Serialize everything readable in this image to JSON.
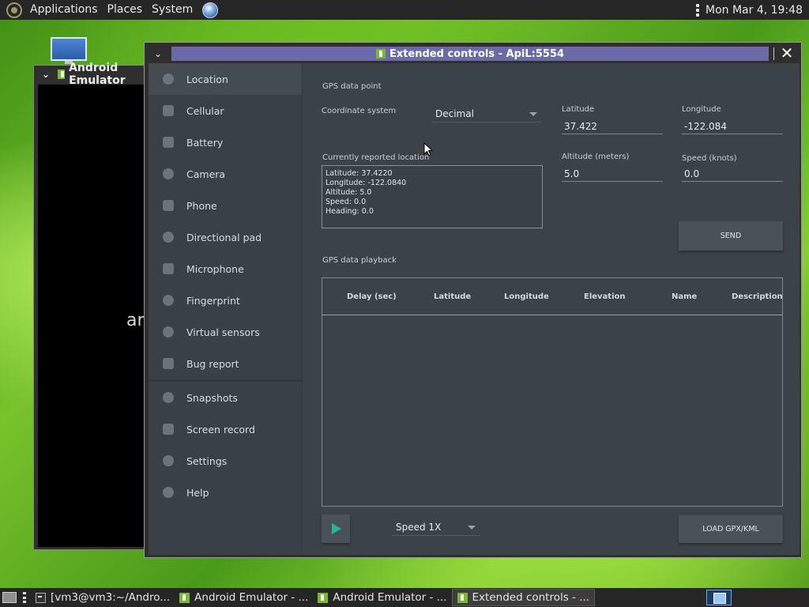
{
  "top_panel": {
    "menus": [
      "Applications",
      "Places",
      "System"
    ],
    "clock": "Mon Mar  4, 19:48"
  },
  "background_window": {
    "title": "Android Emulator",
    "screen_text": "an"
  },
  "window": {
    "title": "Extended controls - ApiL:5554",
    "close_label": "✕"
  },
  "sidebar": {
    "items": [
      {
        "label": "Location",
        "icon": "location-icon"
      },
      {
        "label": "Cellular",
        "icon": "signal-icon"
      },
      {
        "label": "Battery",
        "icon": "battery-icon"
      },
      {
        "label": "Camera",
        "icon": "camera-icon"
      },
      {
        "label": "Phone",
        "icon": "phone-icon"
      },
      {
        "label": "Directional pad",
        "icon": "dpad-icon"
      },
      {
        "label": "Microphone",
        "icon": "microphone-icon"
      },
      {
        "label": "Fingerprint",
        "icon": "fingerprint-icon"
      },
      {
        "label": "Virtual sensors",
        "icon": "sensors-icon"
      },
      {
        "label": "Bug report",
        "icon": "bug-icon"
      }
    ],
    "items2": [
      {
        "label": "Snapshots",
        "icon": "history-icon"
      },
      {
        "label": "Screen record",
        "icon": "video-icon"
      },
      {
        "label": "Settings",
        "icon": "gear-icon"
      },
      {
        "label": "Help",
        "icon": "help-icon"
      }
    ]
  },
  "location": {
    "gps_point_heading": "GPS data point",
    "coordinate_system_label": "Coordinate system",
    "coordinate_system_value": "Decimal",
    "latitude_label": "Latitude",
    "latitude_value": "37.422",
    "longitude_label": "Longitude",
    "longitude_value": "-122.084",
    "altitude_label": "Altitude (meters)",
    "altitude_value": "5.0",
    "speed_label": "Speed (knots)",
    "speed_value": "0.0",
    "reported_label": "Currently reported location",
    "reported_lines": [
      "Latitude: 37.4220",
      "Longitude: -122.0840",
      "Altitude: 5.0",
      "Speed: 0.0",
      "Heading: 0.0"
    ],
    "send_label": "SEND",
    "playback_heading": "GPS data playback",
    "table_headers": [
      "Delay (sec)",
      "Latitude",
      "Longitude",
      "Elevation",
      "Name",
      "Description"
    ],
    "speed_select": "Speed 1X",
    "load_label": "LOAD GPX/KML"
  },
  "taskbar": {
    "tasks": [
      {
        "label": "[vm3@vm3:~/Andro...",
        "icon": "terminal-icon"
      },
      {
        "label": "Android Emulator - ...",
        "icon": "android-icon"
      },
      {
        "label": "Android Emulator - ...",
        "icon": "android-icon"
      },
      {
        "label": "Extended controls - ...",
        "icon": "android-icon"
      }
    ]
  },
  "colors": {
    "accent_play": "#27b59a",
    "title_bar": "#6a6aa8",
    "panel_bg": "#3c4348"
  }
}
